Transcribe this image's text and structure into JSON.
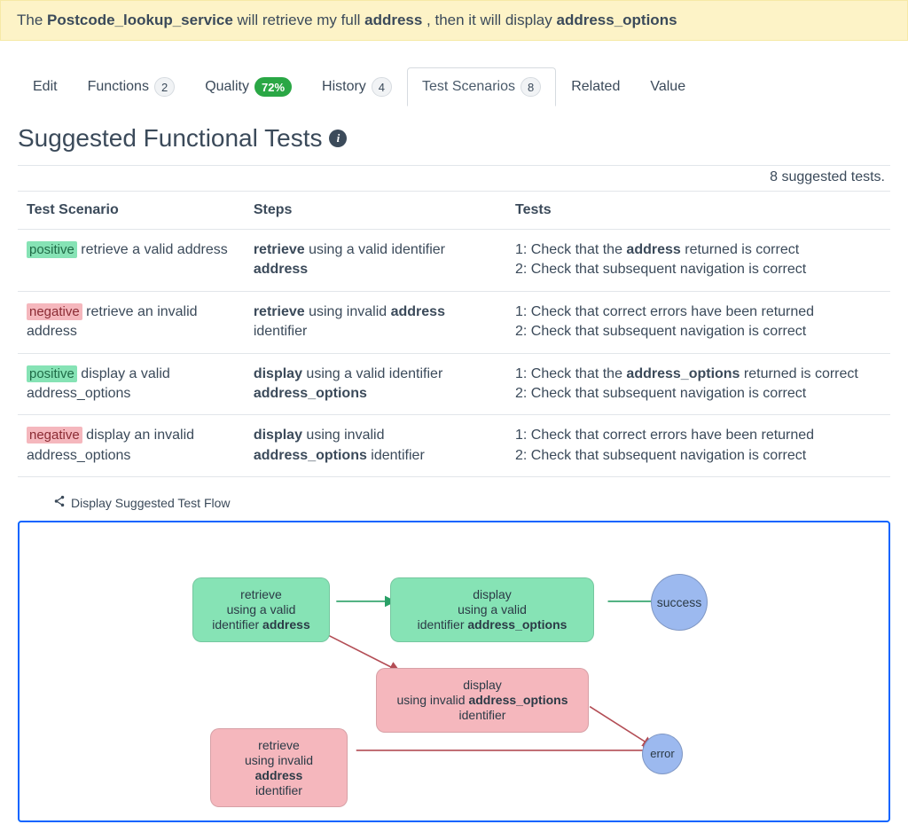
{
  "banner": {
    "prefix": "The ",
    "service": "Postcode_lookup_service",
    "mid1": " will retrieve my full ",
    "obj1": "address",
    "mid2": " , then it will display ",
    "obj2": "address_options"
  },
  "tabs": {
    "edit": "Edit",
    "functions": "Functions",
    "functions_count": "2",
    "quality": "Quality",
    "quality_pct": "72%",
    "history": "History",
    "history_count": "4",
    "scenarios": "Test Scenarios",
    "scenarios_count": "8",
    "related": "Related",
    "value": "Value"
  },
  "section": {
    "title": "Suggested Functional Tests",
    "summary": "8 suggested tests."
  },
  "headers": {
    "scenario": "Test Scenario",
    "steps": "Steps",
    "tests": "Tests"
  },
  "rows": [
    {
      "tag_type": "positive",
      "tag": "positive",
      "scenario_rest": " retrieve a valid address",
      "steps_pre": "retrieve",
      "steps_mid": " using a valid identifier ",
      "steps_obj": "address",
      "steps_post": "",
      "tests": [
        {
          "n": "1:",
          "pre": " Check that the ",
          "obj": "address",
          "post": " returned is correct"
        },
        {
          "n": "2:",
          "pre": " Check that subsequent navigation is correct",
          "obj": "",
          "post": ""
        }
      ]
    },
    {
      "tag_type": "negative",
      "tag": "negative",
      "scenario_rest": " retrieve an invalid address",
      "steps_pre": "retrieve",
      "steps_mid": " using invalid ",
      "steps_obj": "address",
      "steps_post": " identifier",
      "tests": [
        {
          "n": "1:",
          "pre": " Check that correct errors have been returned",
          "obj": "",
          "post": ""
        },
        {
          "n": "2:",
          "pre": " Check that subsequent navigation is correct",
          "obj": "",
          "post": ""
        }
      ]
    },
    {
      "tag_type": "positive",
      "tag": "positive",
      "scenario_rest": " display a valid address_options",
      "steps_pre": "display",
      "steps_mid": " using a valid identifier ",
      "steps_obj": "address_options",
      "steps_post": "",
      "tests": [
        {
          "n": "1:",
          "pre": " Check that the ",
          "obj": "address_options",
          "post": " returned is correct"
        },
        {
          "n": "2:",
          "pre": " Check that subsequent navigation is correct",
          "obj": "",
          "post": ""
        }
      ]
    },
    {
      "tag_type": "negative",
      "tag": "negative",
      "scenario_rest": " display an invalid address_options",
      "steps_pre": "display",
      "steps_mid": " using invalid ",
      "steps_obj": "address_options",
      "steps_post": " identifier",
      "tests": [
        {
          "n": "1:",
          "pre": " Check that correct errors have been returned",
          "obj": "",
          "post": ""
        },
        {
          "n": "2:",
          "pre": " Check that subsequent navigation is correct",
          "obj": "",
          "post": ""
        }
      ]
    }
  ],
  "flow_toggle": "Display Suggested Test Flow",
  "flow": {
    "n1": {
      "l1": "retrieve",
      "l2": "using a valid",
      "l3": "identifier ",
      "l3b": "address"
    },
    "n2": {
      "l1": "display",
      "l2": "using a valid",
      "l3": "identifier ",
      "l3b": "address_options"
    },
    "n3": {
      "l1": "display",
      "l2": "using invalid ",
      "l2b": "address_options",
      "l3": "identifier"
    },
    "n4": {
      "l1": "retrieve",
      "l2": "using invalid ",
      "l2b": "address",
      "l3": "identifier"
    },
    "success": "success",
    "error": "error"
  }
}
